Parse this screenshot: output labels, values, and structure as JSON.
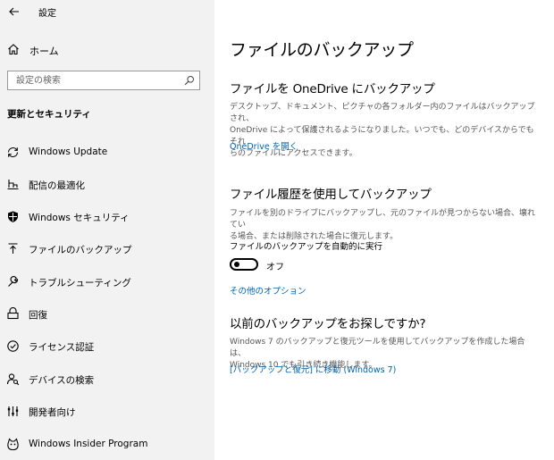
{
  "window": {
    "title": "設定"
  },
  "sidebar": {
    "home_label": "ホーム",
    "search_placeholder": "設定の検索",
    "section_heading": "更新とセキュリティ",
    "items": [
      {
        "label": "Windows Update",
        "icon": "sync-icon"
      },
      {
        "label": "配信の最適化",
        "icon": "delivery-optimization-icon"
      },
      {
        "label": "Windows セキュリティ",
        "icon": "shield-icon"
      },
      {
        "label": "ファイルのバックアップ",
        "icon": "backup-arrow-icon"
      },
      {
        "label": "トラブルシューティング",
        "icon": "wrench-icon"
      },
      {
        "label": "回復",
        "icon": "recovery-icon"
      },
      {
        "label": "ライセンス認証",
        "icon": "check-circle-icon"
      },
      {
        "label": "デバイスの検索",
        "icon": "person-search-icon"
      },
      {
        "label": "開発者向け",
        "icon": "developer-icon"
      },
      {
        "label": "Windows Insider Program",
        "icon": "insider-cat-icon"
      }
    ]
  },
  "main": {
    "title": "ファイルのバックアップ",
    "onedrive": {
      "heading": "ファイルを OneDrive にバックアップ",
      "desc1": "デスクトップ、ドキュメント、ピクチャの各フォルダー内のファイルはバックアップされ、",
      "desc2": "OneDrive によって保護されるようになりました。いつでも、どのデバイスからでもそれ",
      "desc3": "らのファイルにアクセスできます。",
      "link": "OneDrive を開く"
    },
    "history": {
      "heading": "ファイル履歴を使用してバックアップ",
      "desc1": "ファイルを別のドライブにバックアップし、元のファイルが見つからない場合、壊れてい",
      "desc2": "る場合、または削除された場合に復元します。",
      "toggle_label": "ファイルのバックアップを自動的に実行",
      "toggle_state": "オフ",
      "toggle_on": false,
      "more_options": "その他のオプション"
    },
    "older": {
      "heading": "以前のバックアップをお探しですか?",
      "desc1": "Windows 7 のバックアップと復元ツールを使用してバックアップを作成した場合は、",
      "desc2": "Windows 10 でも引き続き機能します。",
      "link": "[バックアップと復元] に移動 (Windows 7)"
    }
  },
  "colors": {
    "accent": "#0063b1",
    "sidebar_bg": "#f2f2f2"
  }
}
